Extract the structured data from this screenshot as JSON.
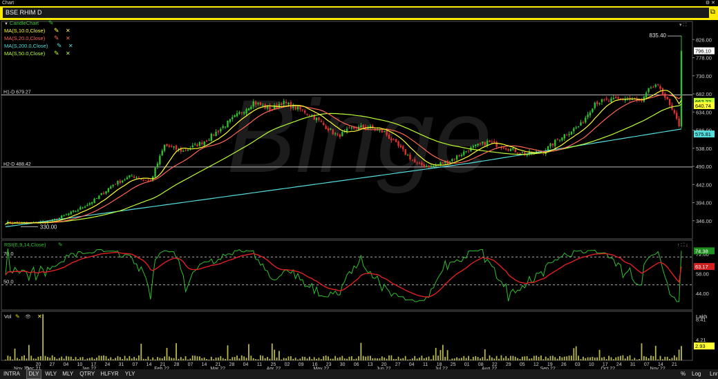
{
  "window": {
    "title": "Chart",
    "menu_icon": "menu-icon",
    "close_icon": "close-icon"
  },
  "header": {
    "symbol": "BSE RHIM D",
    "pin_icon": "restore-icon"
  },
  "price_panel": {
    "legend": [
      {
        "label": "CandleChart",
        "color": "#3fbf3f",
        "edit_icon": "pencil-icon"
      },
      {
        "label": "MA(S,10.0,Close)",
        "color": "#ffff33",
        "edit_icon": "pencil-icon",
        "remove_icon": "close-icon"
      },
      {
        "label": "MA(S,20.0,Close)",
        "color": "#ff6655",
        "edit_icon": "pencil-icon",
        "remove_icon": "close-icon"
      },
      {
        "label": "MA(S,200.0,Close)",
        "color": "#55dddd",
        "edit_icon": "pencil-icon",
        "remove_icon": "close-icon"
      },
      {
        "label": "MA(S,50.0,Close)",
        "color": "#bbff33",
        "edit_icon": "pencil-icon",
        "remove_icon": "close-icon"
      }
    ],
    "lines": [
      {
        "label": "H1-D 679.27",
        "value": 679.27
      },
      {
        "label": "H2-D 488.42",
        "value": 488.42
      }
    ],
    "annotations": [
      {
        "text": "835.40",
        "value": 835.4
      },
      {
        "text": "330.00",
        "value": 330.0
      }
    ],
    "price_tags": [
      {
        "text": "796.10",
        "value": 796.1,
        "bg": "#ffffff",
        "fg": "#000000"
      },
      {
        "text": "662.22",
        "value": 662.22,
        "bg": "#bbff33",
        "fg": "#000000"
      },
      {
        "text": "640.74",
        "value": 651,
        "bg": "#ffff33",
        "fg": "#000000"
      },
      {
        "text": "575.81",
        "value": 575.81,
        "bg": "#55dddd",
        "fg": "#000000"
      }
    ],
    "yticks": [
      "826.00",
      "778.00",
      "730.00",
      "682.00",
      "634.00",
      "586.00",
      "538.00",
      "490.00",
      "442.00",
      "394.00",
      "346.00"
    ],
    "ylim": [
      298,
      874
    ],
    "watermark": "Binge"
  },
  "rsi_panel": {
    "legend": "RSI(E,9,14,Close)",
    "levels": [
      {
        "label": "70.0",
        "value": 70
      },
      {
        "label": "50.0",
        "value": 50
      }
    ],
    "yticks": [
      "72.00",
      "58.00",
      "44.00"
    ],
    "ylim": [
      32,
      82
    ],
    "price_tags": [
      {
        "text": "74.38",
        "value": 74.38,
        "bg": "#1f8f1f"
      },
      {
        "text": "63.17",
        "value": 63.17,
        "bg": "#d02020"
      }
    ]
  },
  "volume_panel": {
    "legend": "Vol",
    "unit": "Lakh",
    "yticks": [
      "8.41",
      "4.21"
    ],
    "ylim": [
      0,
      10
    ],
    "price_tag": {
      "text": "2.93",
      "value": 2.93
    }
  },
  "x_axis": {
    "labels": [
      {
        "text": "Nov 21",
        "i": 3
      },
      {
        "text": "20",
        "i": 12
      },
      {
        "text": "27",
        "i": 17
      },
      {
        "text": "Dec 21",
        "i": 8
      },
      {
        "text": "Jan 22",
        "i": 32
      },
      {
        "text": "Feb 22",
        "i": 63
      },
      {
        "text": "Mar 22",
        "i": 87
      },
      {
        "text": "Apr 22",
        "i": 111
      },
      {
        "text": "May 22",
        "i": 131
      },
      {
        "text": "Jun 22",
        "i": 158
      },
      {
        "text": "Jul 22",
        "i": 183
      },
      {
        "text": "Aug 22",
        "i": 203
      },
      {
        "text": "Sep 22",
        "i": 228
      },
      {
        "text": "Oct 22",
        "i": 254
      },
      {
        "text": "Nov 22",
        "i": 275
      }
    ],
    "ticks": [
      "20",
      "27",
      "04",
      "10",
      "17",
      "24",
      "31",
      "07",
      "14",
      "21",
      "28",
      "07",
      "14",
      "21",
      "28",
      "04",
      "11",
      "25",
      "02",
      "09",
      "16",
      "23",
      "30",
      "06",
      "13",
      "20",
      "27",
      "04",
      "11",
      "18",
      "25",
      "01",
      "08",
      "22",
      "29",
      "05",
      "12",
      "19",
      "26",
      "03",
      "10",
      "17",
      "24",
      "31",
      "07",
      "14",
      "21"
    ]
  },
  "chart_data": {
    "type": "candlestick",
    "symbol": "BSE RHIM D",
    "bars": 290,
    "ylim": [
      298,
      874
    ],
    "last_close": 796.1,
    "high_marker": 835.4,
    "low_marker": 330.0,
    "series": [
      {
        "name": "MA(S,10.0,Close)",
        "last": 640.74
      },
      {
        "name": "MA(S,20.0,Close)"
      },
      {
        "name": "MA(S,200.0,Close)",
        "last": 575.81
      },
      {
        "name": "MA(S,50.0,Close)",
        "last": 662.22
      }
    ],
    "close_anchors": [
      [
        0,
        341
      ],
      [
        10,
        339
      ],
      [
        20,
        346
      ],
      [
        30,
        372
      ],
      [
        38,
        400
      ],
      [
        46,
        442
      ],
      [
        54,
        465
      ],
      [
        62,
        450
      ],
      [
        68,
        546
      ],
      [
        76,
        530
      ],
      [
        86,
        560
      ],
      [
        96,
        610
      ],
      [
        106,
        660
      ],
      [
        114,
        640
      ],
      [
        118,
        660
      ],
      [
        124,
        645
      ],
      [
        130,
        630
      ],
      [
        136,
        600
      ],
      [
        142,
        570
      ],
      [
        148,
        590
      ],
      [
        154,
        595
      ],
      [
        162,
        580
      ],
      [
        170,
        530
      ],
      [
        176,
        495
      ],
      [
        182,
        490
      ],
      [
        190,
        505
      ],
      [
        198,
        535
      ],
      [
        206,
        555
      ],
      [
        214,
        540
      ],
      [
        222,
        522
      ],
      [
        230,
        530
      ],
      [
        238,
        570
      ],
      [
        246,
        600
      ],
      [
        252,
        660
      ],
      [
        260,
        665
      ],
      [
        266,
        670
      ],
      [
        272,
        660
      ],
      [
        276,
        700
      ],
      [
        280,
        698
      ],
      [
        284,
        650
      ],
      [
        288,
        600
      ],
      [
        292,
        580
      ],
      [
        294,
        575
      ],
      [
        296,
        600
      ],
      [
        298,
        660
      ],
      [
        300,
        700
      ],
      [
        301,
        796
      ]
    ],
    "rsi": {
      "name": "RSI(E,9,14,Close)",
      "last": 74.38,
      "signal_last": 63.17
    },
    "volume": {
      "unit": "Lakh",
      "last": 2.93
    }
  },
  "timeframes": [
    {
      "label": "INTRA"
    },
    {
      "label": "DLY",
      "selected": true
    },
    {
      "label": "WLY"
    },
    {
      "label": "MLY"
    },
    {
      "label": "QTRY"
    },
    {
      "label": "HLFYR"
    },
    {
      "label": "YLY"
    }
  ],
  "scale_options": [
    {
      "label": "%"
    },
    {
      "label": "Log"
    },
    {
      "label": "Lnr"
    }
  ]
}
